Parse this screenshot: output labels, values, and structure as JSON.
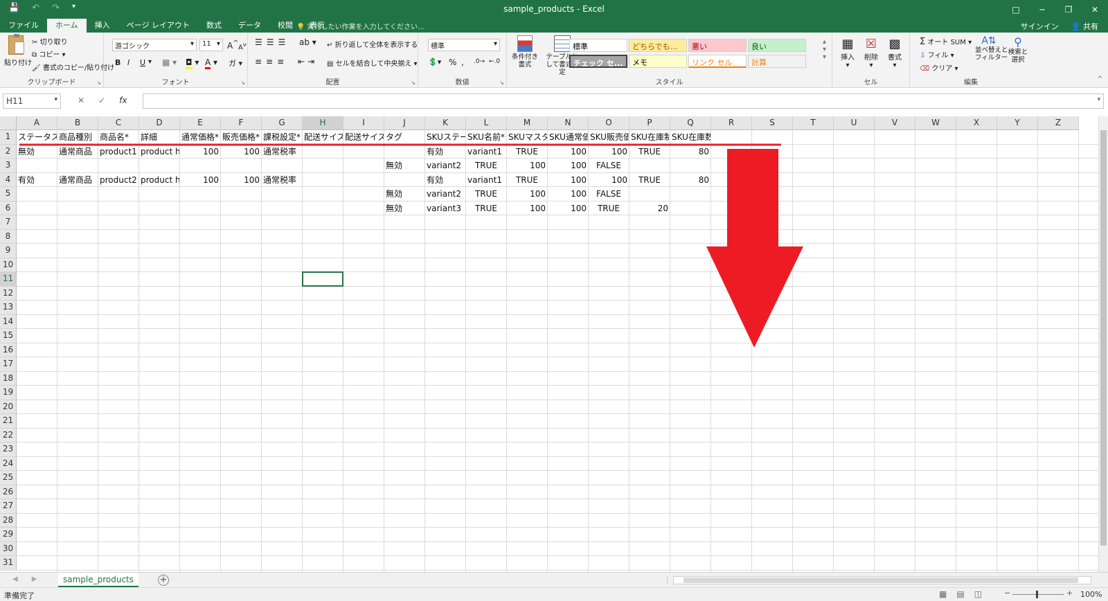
{
  "window": {
    "title": "sample_products - Excel",
    "qat_icons": [
      "save-icon",
      "undo-icon",
      "redo-icon",
      "customize-qat-icon"
    ],
    "buttons": {
      "ribbon_options": "□",
      "minimize": "─",
      "restore": "❐",
      "close": "✕"
    }
  },
  "tabs": [
    {
      "label": "ファイル",
      "active": false
    },
    {
      "label": "ホーム",
      "active": true
    },
    {
      "label": "挿入",
      "active": false
    },
    {
      "label": "ページ レイアウト",
      "active": false
    },
    {
      "label": "数式",
      "active": false
    },
    {
      "label": "データ",
      "active": false
    },
    {
      "label": "校閲",
      "active": false
    },
    {
      "label": "表示",
      "active": false
    }
  ],
  "tell_me": "実行したい作業を入力してください...",
  "account": {
    "signin": "サインイン",
    "share": "共有"
  },
  "ribbon": {
    "clipboard": {
      "label": "クリップボード",
      "paste": "貼り付け",
      "cut": "切り取り",
      "copy": "コピー",
      "format_painter": "書式のコピー/貼り付け"
    },
    "font": {
      "label": "フォント",
      "font_name": "游ゴシック",
      "font_size": "11",
      "bold": "B",
      "italic": "I",
      "underline": "U",
      "grow": "A",
      "shrink": "A"
    },
    "alignment": {
      "label": "配置",
      "wrap_text": "折り返して全体を表示する",
      "merge_center": "セルを結合して中央揃え"
    },
    "number": {
      "label": "数値",
      "format": "標準",
      "percent": "%",
      "comma": ","
    },
    "styles": {
      "label": "スタイル",
      "conditional": "条件付き書式",
      "as_table": "テーブルとして書式設定",
      "cells": [
        {
          "label": "標準",
          "bg": "#ffffff",
          "color": "#000000"
        },
        {
          "label": "どちらでも...",
          "bg": "#ffeb9c",
          "color": "#9c5700"
        },
        {
          "label": "悪い",
          "bg": "#ffc7ce",
          "color": "#9c0006"
        },
        {
          "label": "良い",
          "bg": "#c6efce",
          "color": "#006100"
        },
        {
          "label": "チェック セ...",
          "bg": "#a5a5a5",
          "color": "#ffffff"
        },
        {
          "label": "メモ",
          "bg": "#ffffcc",
          "color": "#000000"
        },
        {
          "label": "リンク セル",
          "bg": "#ffffff",
          "color": "#fa7d00"
        },
        {
          "label": "計算",
          "bg": "#f2f2f2",
          "color": "#fa7d00"
        }
      ]
    },
    "cells": {
      "label": "セル",
      "insert": "挿入",
      "delete": "削除",
      "format": "書式"
    },
    "editing": {
      "label": "編集",
      "autosum": "オート SUM",
      "fill": "フィル",
      "clear": "クリア",
      "sort_filter": "並べ替えと\nフィルター",
      "find_select": "検索と\n選択"
    }
  },
  "formula_bar": {
    "name_box": "H11",
    "cancel": "✕",
    "enter": "✓",
    "fx": "fx",
    "value": ""
  },
  "sheet": {
    "columns": [
      "A",
      "B",
      "C",
      "D",
      "E",
      "F",
      "G",
      "H",
      "I",
      "J",
      "K",
      "L",
      "M",
      "N",
      "O",
      "P",
      "Q",
      "R",
      "S",
      "T",
      "U",
      "V",
      "W",
      "X",
      "Y",
      "Z"
    ],
    "selected_column": "H",
    "selected_row": 11,
    "row_count": 31,
    "headers": [
      "ステータス",
      "商品種別",
      "商品名*",
      "詳細",
      "通常価格*",
      "販売価格*",
      "課税設定*",
      "配送サイズ",
      "配送サイズ",
      "タグ",
      "SKUステータス",
      "SKU名前*",
      "SKUマスター",
      "SKU通常価格",
      "SKU販売価格",
      "SKU在庫制限",
      "SKU在庫数"
    ],
    "rows": [
      {
        "row": 2,
        "cells": {
          "A": "無効",
          "B": "通常商品",
          "C": "product1",
          "D": "product has SKUs",
          "E": "100",
          "F": "100",
          "G": "通常税率",
          "K": "有効",
          "L": "variant1",
          "M": "TRUE",
          "N": "100",
          "O": "100",
          "P": "TRUE",
          "Q": "80"
        }
      },
      {
        "row": 3,
        "cells": {
          "J": "無効",
          "K": "variant2",
          "L": "TRUE",
          "M": "100",
          "N": "100",
          "O": "FALSE"
        }
      },
      {
        "row": 4,
        "cells": {
          "A": "有効",
          "B": "通常商品",
          "C": "product2",
          "D": "product has SKUs",
          "E": "100",
          "F": "100",
          "G": "通常税率",
          "K": "有効",
          "L": "variant1",
          "M": "TRUE",
          "N": "100",
          "O": "100",
          "P": "TRUE",
          "Q": "80"
        }
      },
      {
        "row": 5,
        "cells": {
          "J": "無効",
          "K": "variant2",
          "L": "TRUE",
          "M": "100",
          "N": "100",
          "O": "FALSE"
        }
      },
      {
        "row": 6,
        "cells": {
          "J": "無効",
          "K": "variant3",
          "L": "TRUE",
          "M": "100",
          "N": "100",
          "O": "TRUE",
          "P": "20"
        }
      }
    ],
    "tab_name": "sample_products"
  },
  "annotation": {
    "underline_color": "#e8202a",
    "arrow_color": "#ed1c24"
  },
  "status": {
    "ready": "準備完了",
    "zoom": "100%",
    "zoom_minus": "−",
    "zoom_plus": "+"
  }
}
